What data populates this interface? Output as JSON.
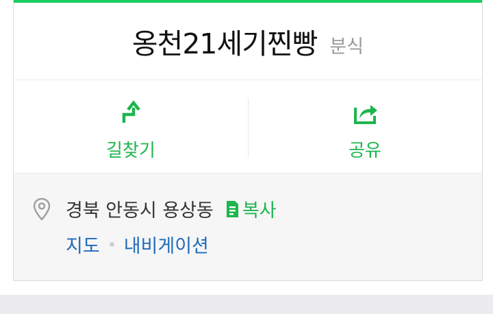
{
  "place": {
    "name": "옹천21세기찐빵",
    "category": "분식"
  },
  "actions": {
    "directions_label": "길찾기",
    "share_label": "공유"
  },
  "info": {
    "address": "경북 안동시 용상동",
    "copy_label": "복사",
    "map_link": "지도",
    "navigation_link": "내비게이션"
  },
  "icons": {
    "directions": "turn-arrow-icon",
    "share": "share-arrow-icon",
    "location": "map-pin-icon",
    "copy": "document-copy-icon"
  },
  "colors": {
    "accent_green": "#19ce60",
    "action_green": "#1db54d",
    "link_blue": "#1f6bb8",
    "title_text": "#111111",
    "category_gray": "#9a9a9a"
  }
}
